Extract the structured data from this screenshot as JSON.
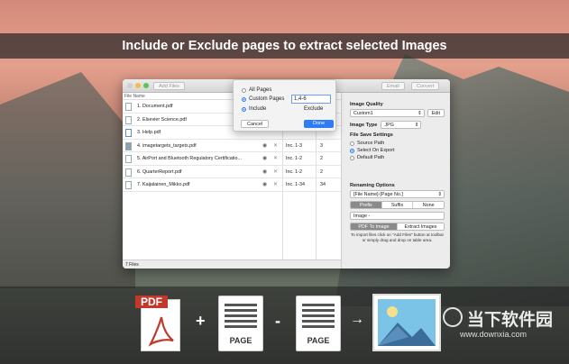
{
  "banner": {
    "text": "Include or Exclude pages to extract selected Images"
  },
  "toolbar": {
    "add_files": "Add Files",
    "email": "Email",
    "convert": "Convert"
  },
  "table": {
    "header_file": "File Name",
    "rows": [
      {
        "name": "1. Document.pdf",
        "range": "",
        "count": ""
      },
      {
        "name": "2. Elsevier Science.pdf",
        "range": "",
        "count": ""
      },
      {
        "name": "3. Help.pdf",
        "range": "",
        "count": ""
      },
      {
        "name": "4. imagetargets_targets.pdf",
        "range": "Inc. 1-3",
        "count": "3"
      },
      {
        "name": "5. AirPort and Bluetooth Regulatory Certificatio...",
        "range": "Inc. 1-2",
        "count": "2"
      },
      {
        "name": "6. QuarterReport.pdf",
        "range": "Inc. 1-2",
        "count": "2"
      },
      {
        "name": "7. Kaijalainen_Mikko.pdf",
        "range": "Inc. 1-34",
        "count": "34"
      }
    ],
    "footer": "7 Files"
  },
  "popover": {
    "all_pages": "All Pages",
    "custom_pages": "Custom Pages",
    "custom_value": "1,4-6",
    "include": "Include",
    "exclude": "Exclude",
    "cancel": "Cancel",
    "done": "Done"
  },
  "panel": {
    "image_quality_title": "Image Quality",
    "quality_value": "Custom1",
    "edit": "Edit",
    "image_type_label": "Image Type",
    "image_type_value": "JPG",
    "save_settings_title": "File Save Settings",
    "source_path": "Source Path",
    "select_on_export": "Select On Export",
    "default_path": "Default Path",
    "renaming_title": "Renaming Options",
    "renaming_value": "[File Name]-[Page No.]",
    "prefix": "Prefix",
    "suffix": "Suffix",
    "none": "None",
    "image_field": "Image -",
    "pdf_to_image": "PDF To Image",
    "extract_images": "Extract Images",
    "hint": "To import files click on \"Add Files\" button at toolbar or simply drag and drop on table area."
  },
  "bottom": {
    "pdf_label": "PDF",
    "page1": "PAGE",
    "page2": "PAGE",
    "plus": "+",
    "minus": "-",
    "arrow": "→",
    "watermark": "当下软件园",
    "watermark_url": "www.downxia.com"
  },
  "colors": {
    "accent": "#2f7cf6",
    "pdf_red": "#c0392b"
  }
}
